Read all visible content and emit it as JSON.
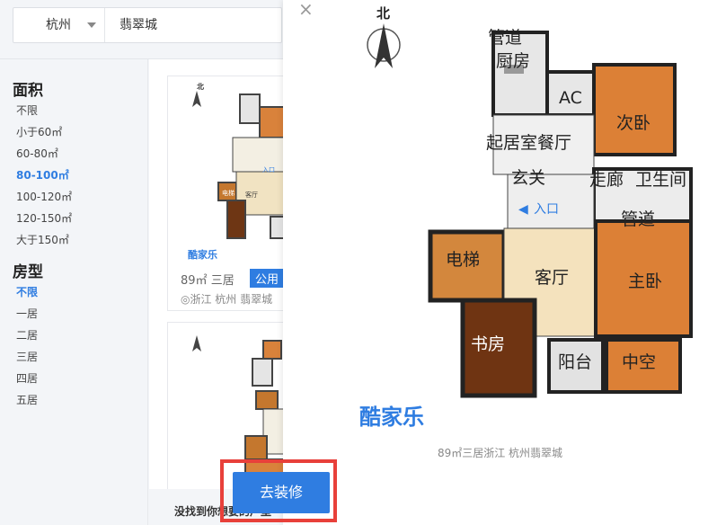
{
  "search": {
    "city": "杭州",
    "query": "翡翠城"
  },
  "filters": {
    "area": {
      "title": "面积",
      "options": [
        "不限",
        "小于60㎡",
        "60-80㎡",
        "80-100㎡",
        "100-120㎡",
        "120-150㎡",
        "大于150㎡"
      ],
      "selected": "80-100㎡"
    },
    "layout": {
      "title": "房型",
      "options": [
        "不限",
        "一居",
        "二居",
        "三居",
        "四居",
        "五居"
      ],
      "selected": "不限"
    }
  },
  "results": {
    "cards": [
      {
        "price": "89㎡",
        "rooms": "三居",
        "badge": "公用",
        "location": "浙江 杭州 翡翠城",
        "brand": "酷家乐"
      }
    ],
    "not_found": "没找到你想要的户型"
  },
  "floorplan": {
    "compass": "北",
    "rooms": {
      "pipe_top": "管道",
      "kitchen": "厨房",
      "ac": "AC",
      "second_bedroom": "次卧",
      "living_dining": "起居室餐厅",
      "foyer": "玄关",
      "corridor": "走廊",
      "bathroom": "卫生间",
      "entrance": "入口",
      "pipe": "管道",
      "elevator": "电梯",
      "living_room": "客厅",
      "master_bedroom": "主卧",
      "study": "书房",
      "balcony": "阳台",
      "void": "中空"
    },
    "brand": "酷家乐"
  },
  "modal": {
    "close": "×",
    "caption": "89㎡三居浙江 杭州翡翠城",
    "action": "去装修"
  },
  "colors": {
    "accent": "#2f7de1",
    "highlight": "#e8403a",
    "wood": "#d9823b"
  }
}
